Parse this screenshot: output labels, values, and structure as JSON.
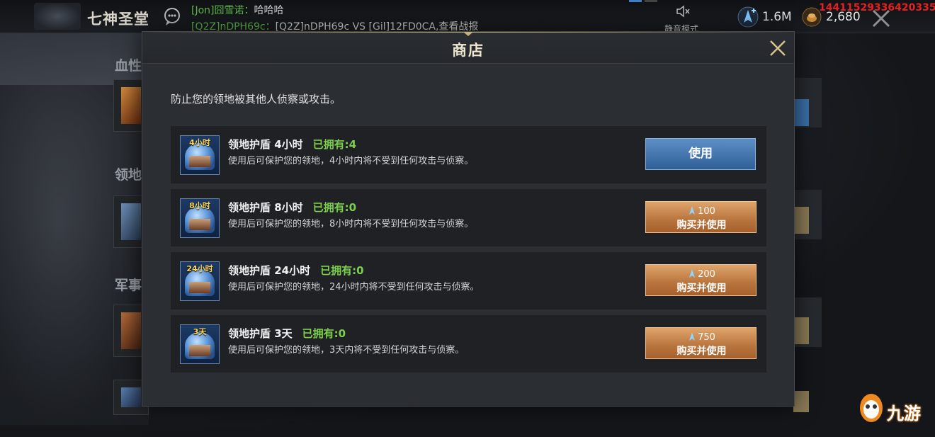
{
  "topbar": {
    "realm_title": "七神圣堂",
    "chat": [
      {
        "prefix": "[Jon]囧雪诺：",
        "text": "哈哈哈"
      },
      {
        "prefix": "[Q2Z]nDPH69c：",
        "text": "[Q2Z]nDPH69c VS [Gil]12FD0CA,查看战报"
      }
    ],
    "mute_label": "静音模式",
    "crystal_amount": "1.6M",
    "gold_amount": "2,680",
    "user_id": "14411529336420335"
  },
  "background": {
    "section_labels": [
      "血性",
      "领地",
      "军事"
    ]
  },
  "modal": {
    "title": "商店",
    "description": "防止您的领地被其他人侦察或攻击。",
    "items": [
      {
        "tag": "4小时",
        "name": "领地护盾 4小时",
        "owned": "已拥有:4",
        "desc": "使用后可保护您的领地，4小时内将不受到任何攻击与侦察。",
        "action": "use",
        "button_label": "使用",
        "price": ""
      },
      {
        "tag": "8小时",
        "name": "领地护盾 8小时",
        "owned": "已拥有:0",
        "desc": "使用后可保护您的领地，8小时内将不受到任何攻击与侦察。",
        "action": "buy",
        "button_label": "购买并使用",
        "price": "100"
      },
      {
        "tag": "24小时",
        "name": "领地护盾 24小时",
        "owned": "已拥有:0",
        "desc": "使用后可保护您的领地，24小时内将不受到任何攻击与侦察。",
        "action": "buy",
        "button_label": "购买并使用",
        "price": "200"
      },
      {
        "tag": "3天",
        "name": "领地护盾 3天",
        "owned": "已拥有:0",
        "desc": "使用后可保护您的领地，3天内将不受到任何攻击与侦察。",
        "action": "buy",
        "button_label": "购买并使用",
        "price": "750"
      }
    ]
  },
  "watermark": {
    "text": "九游"
  },
  "icons": {
    "chat": "chat-bubble-icon",
    "mute": "speaker-mute-icon",
    "crystal": "crystal-resource-icon",
    "gold": "gold-resource-icon",
    "close": "close-icon",
    "gem": "gem-icon",
    "shield": "shield-dome-icon"
  },
  "colors": {
    "chat_name": "#5fb84a",
    "owned": "#7cd04a",
    "use_button": "#2f5f97",
    "buy_button": "#b8743d",
    "user_id": "#e62020",
    "title_gold": "#c9b078"
  }
}
